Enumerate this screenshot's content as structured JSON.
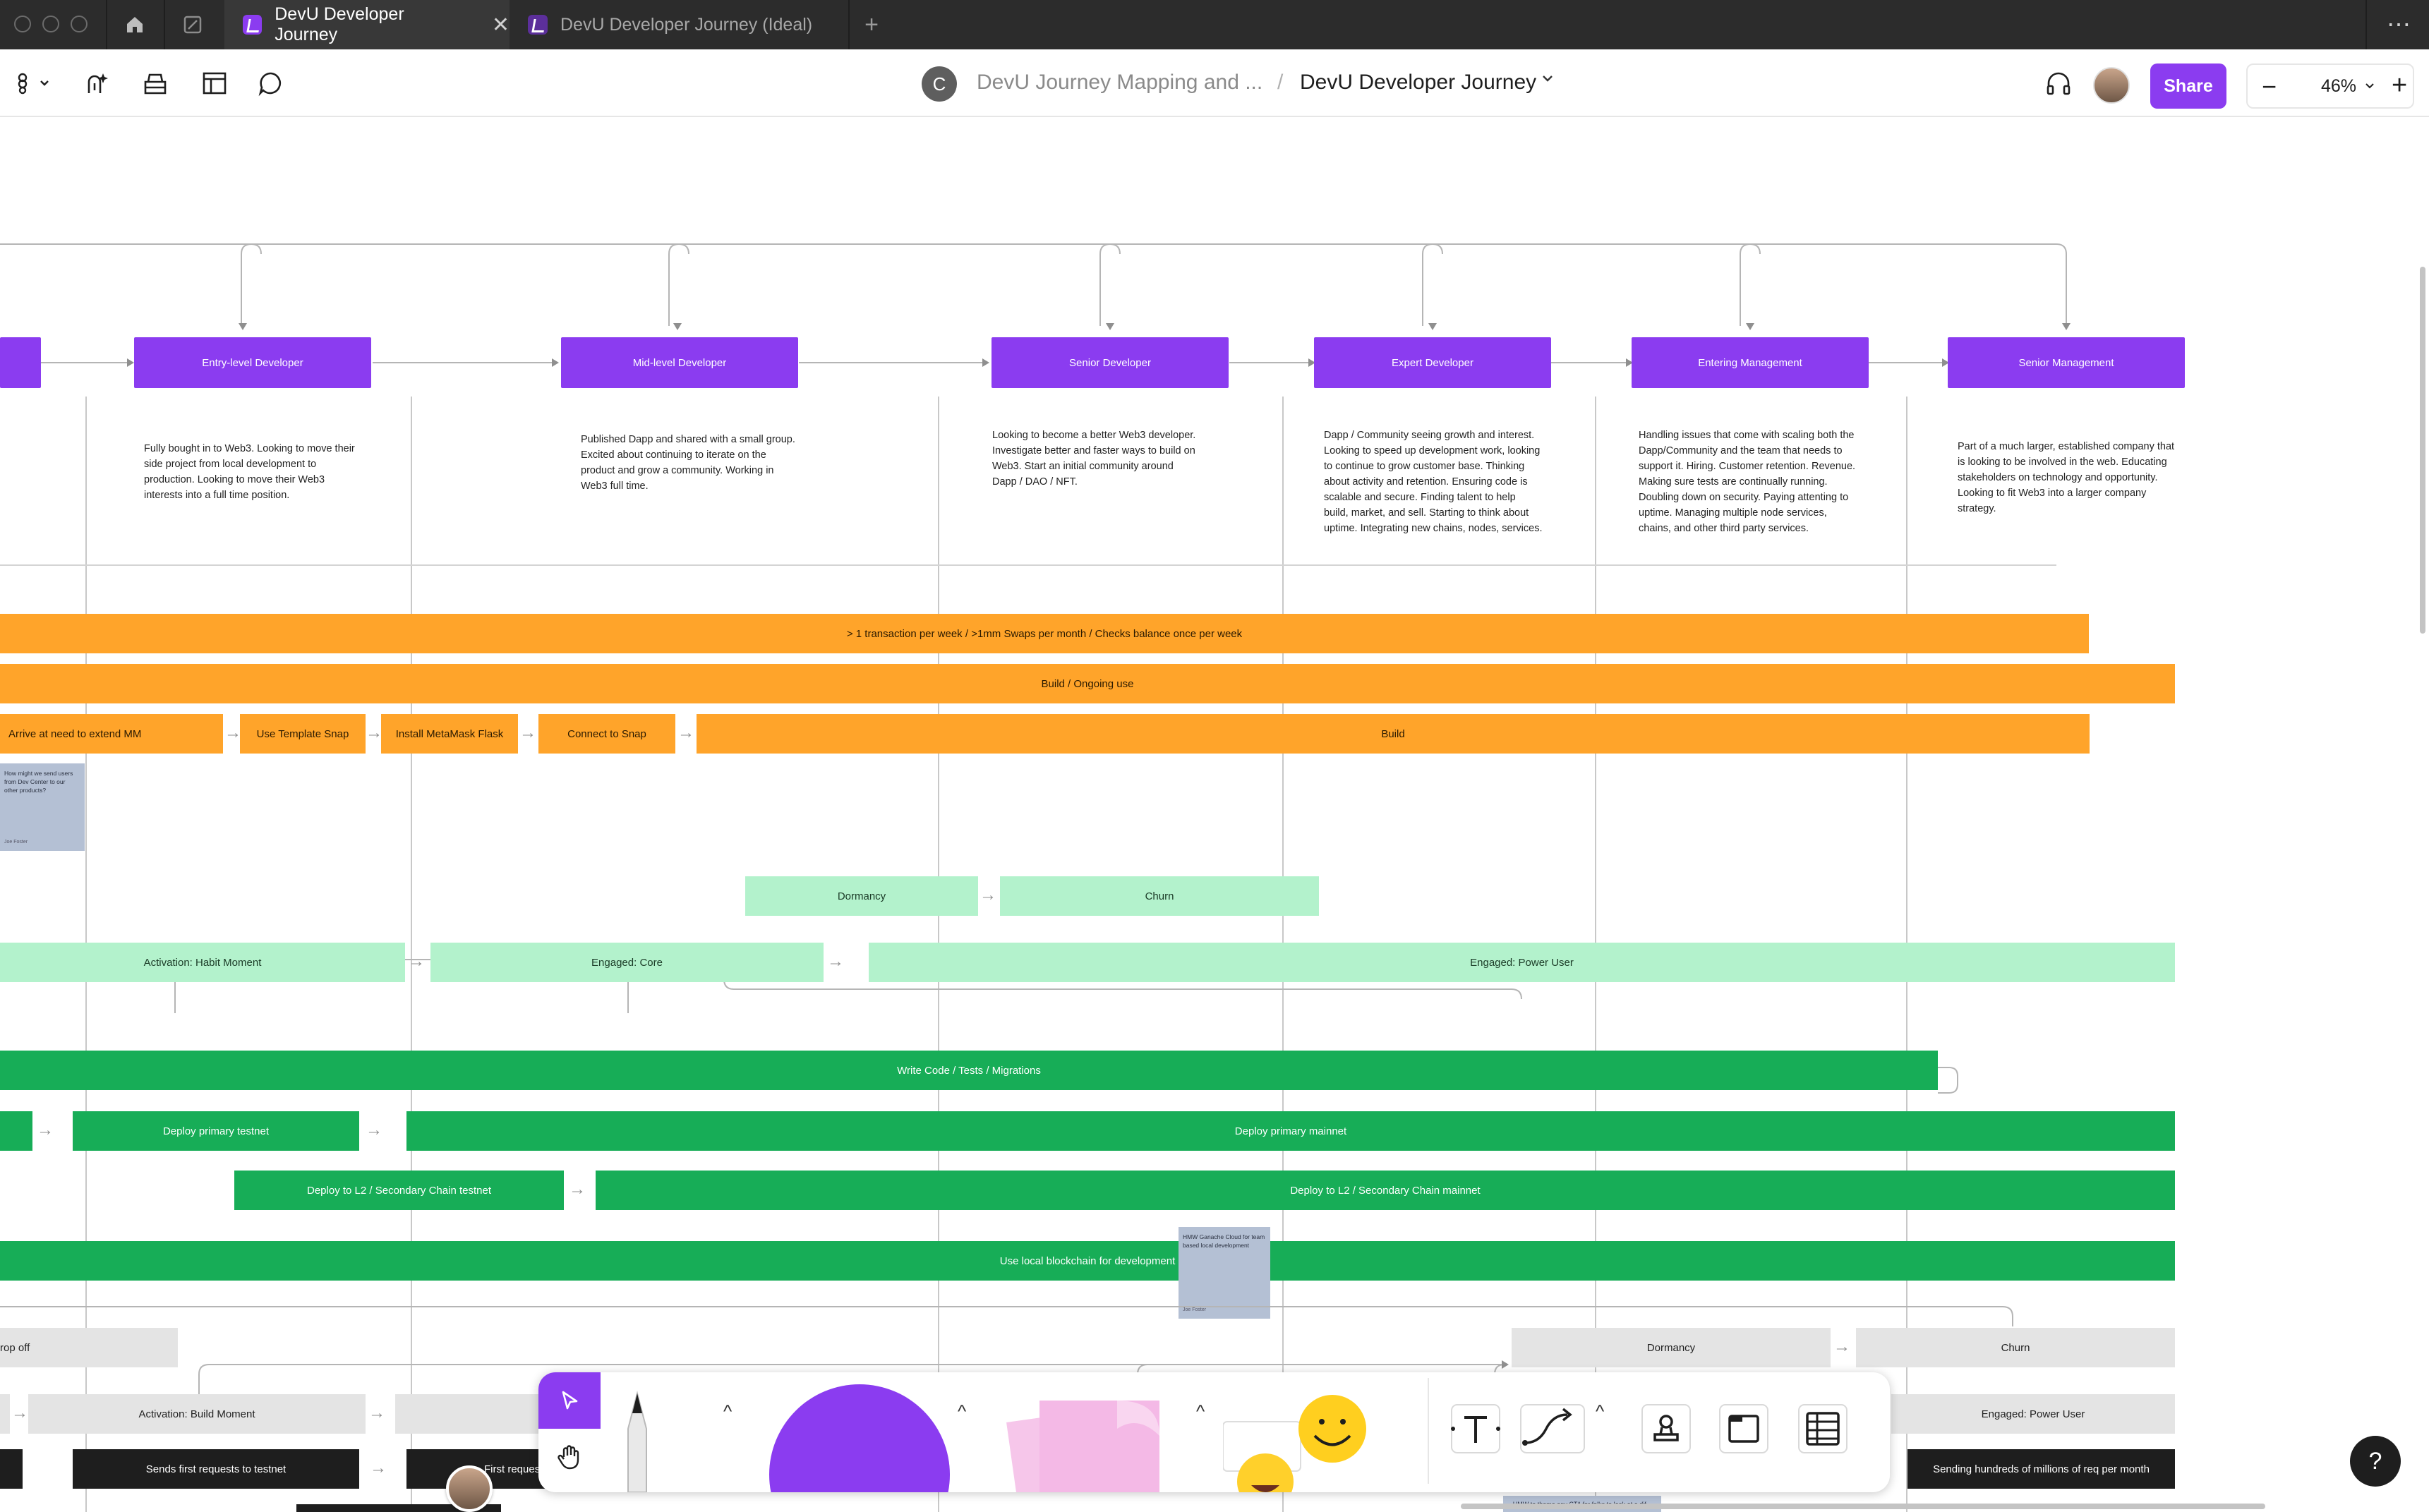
{
  "tabs": [
    {
      "label": "DevU Developer Journey",
      "active": true
    },
    {
      "label": "DevU Developer Journey (Ideal)",
      "active": false
    }
  ],
  "tab_controls": {
    "close": "✕",
    "new": "+",
    "more": "⋯"
  },
  "breadcrumb": {
    "avatar_letter": "C",
    "parent": "DevU Journey Mapping and ...",
    "separator": "/",
    "current": "DevU Developer Journey"
  },
  "share_label": "Share",
  "zoom": {
    "minus": "−",
    "value": "46%",
    "plus": "+"
  },
  "stages": [
    {
      "label": "Entry-level Developer",
      "desc": "Fully bought in to Web3. Looking to move their side project from local development to production. Looking to move their Web3 interests into a full time position."
    },
    {
      "label": "Mid-level Developer",
      "desc": "Published Dapp and shared with a small group. Excited about continuing to iterate on the product and grow a community. Working in Web3 full time."
    },
    {
      "label": "Senior Developer",
      "desc": "Looking to become a better Web3 developer. Investigate better and faster ways to build on Web3. Start an initial community around Dapp / DAO / NFT."
    },
    {
      "label": "Expert Developer",
      "desc": "Dapp / Community seeing growth and interest. Looking to speed up development work, looking to continue to grow customer base. Thinking about activity and retention. Ensuring code is scalable and secure. Finding talent to help build, market, and sell. Starting to think about uptime. Integrating new chains, nodes, services."
    },
    {
      "label": "Entering Management",
      "desc": "Handling issues that come with scaling both the Dapp/Community and the team that needs to support it. Hiring. Customer retention. Revenue. Making sure tests are continually running. Doubling down on security. Paying attenting to uptime. Managing multiple node services, chains, and other third party services."
    },
    {
      "label": "Senior Management",
      "desc": "Part of a much larger, established company that is looking to be involved in the web. Educating stakeholders on technology and opportunity. Looking to fit Web3 into a larger company strategy."
    }
  ],
  "orange_rows": {
    "usage": "> 1 transaction per week / >1mm Swaps per month / Checks balance once per week",
    "ongoing": "Build / Ongoing use",
    "steps": [
      "Arrive at need to extend MM",
      "Use Template Snap",
      "Install MetaMask Flask",
      "Connect to Snap",
      "Build"
    ]
  },
  "sticky_1": {
    "text": "How might we send users from Dev Center to our other products?",
    "author": "Joe Foster"
  },
  "mint_rows": {
    "dormancy": "Dormancy",
    "churn": "Churn",
    "steps": [
      "Activation: Habit Moment",
      "Engaged: Core",
      "Engaged: Power User"
    ]
  },
  "green_rows": {
    "write": "Write Code / Tests / Migrations",
    "deploy_testnet": "Deploy primary testnet",
    "deploy_mainnet": "Deploy primary mainnet",
    "l2_testnet": "Deploy to L2 / Secondary Chain testnet",
    "l2_mainnet": "Deploy to L2 / Secondary Chain mainnet",
    "local": "Use local blockchain for development"
  },
  "sticky_2": {
    "text": "HMW Ganache Cloud for team based local development",
    "author": "Joe Foster"
  },
  "grey_rows": {
    "drop_off": "rop off",
    "dormancy": "Dormancy",
    "churn": "Churn",
    "activation": "Activation: Build Moment",
    "power_user": "Engaged: Power User"
  },
  "black_rows": {
    "first_testnet": "Sends first requests to testnet",
    "first_partial": "First reques",
    "hundreds": "Sending hundreds of millions of req per month"
  },
  "bottom_sticky_text": "HMW to theme any CTA for folks to look at a dif...",
  "help_label": "?",
  "colors": {
    "brand_purple": "#8b3cf0",
    "orange": "#ffa42a",
    "mint": "#b3f2cc",
    "green": "#17ad57",
    "grey": "#e4e4e4",
    "black": "#1e1e1e",
    "sticky": "#b4c0d4"
  },
  "icons": [
    "home-icon",
    "file-icon",
    "figjam-logo-icon",
    "ai-assist-icon",
    "library-icon",
    "layout-icon",
    "comment-icon",
    "headphones-icon",
    "chevron-down-icon",
    "cursor-icon",
    "hand-icon",
    "marker-icon",
    "shape-icon",
    "sticky-icon",
    "emoji-icon",
    "text-icon",
    "connector-icon",
    "stamp-icon",
    "section-icon",
    "table-icon"
  ]
}
